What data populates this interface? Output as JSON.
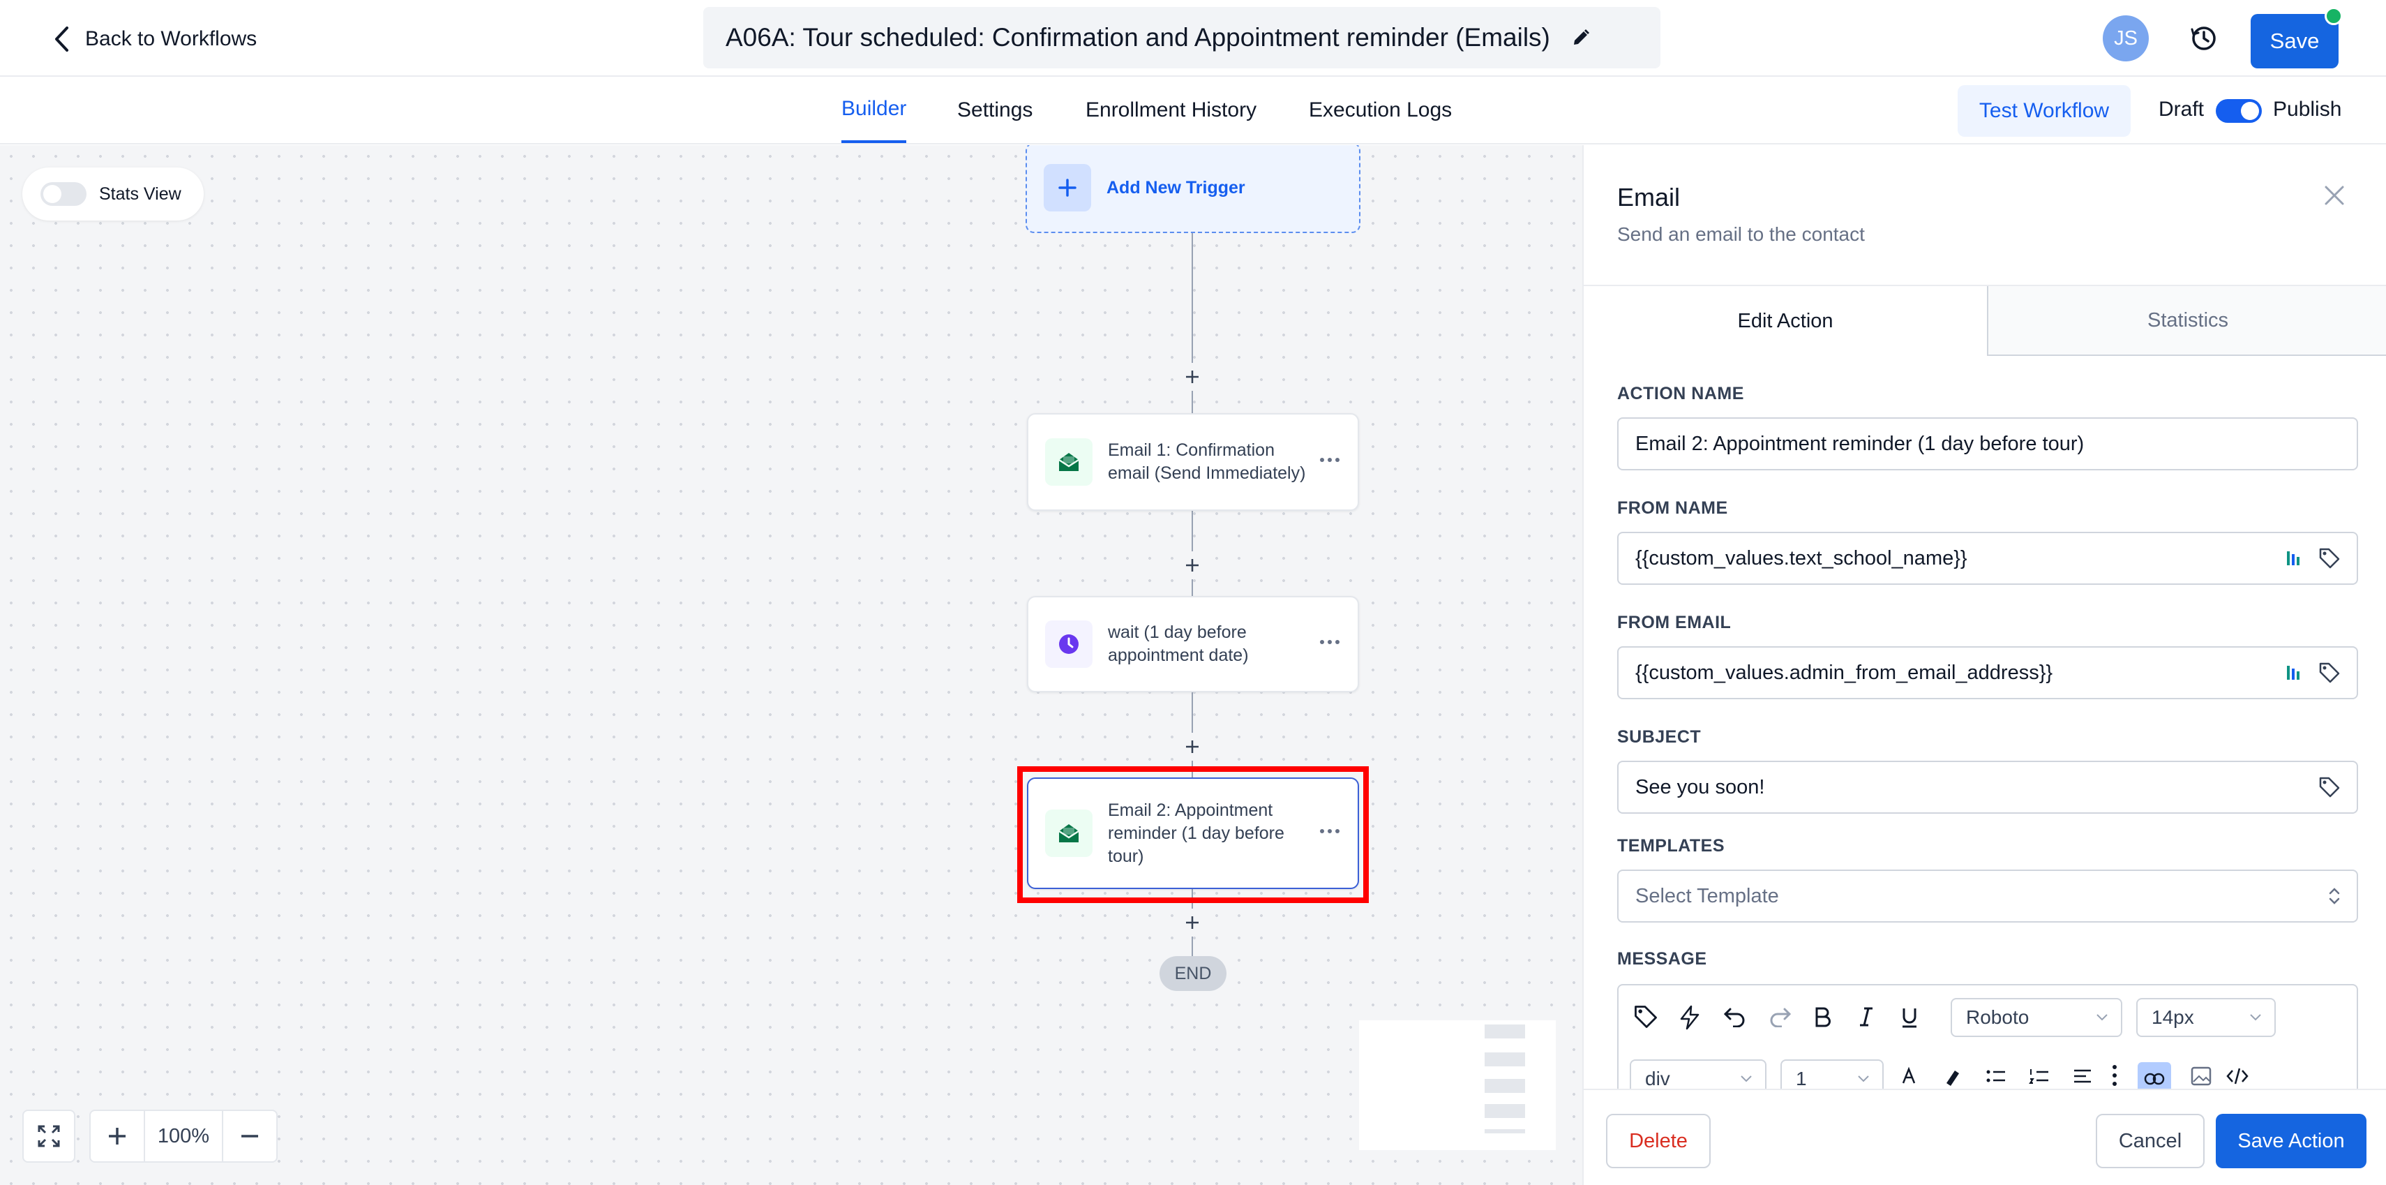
{
  "header": {
    "back_label": "Back to Workflows",
    "workflow_title": "A06A: Tour scheduled: Confirmation and Appointment reminder (Emails)",
    "avatar_initials": "JS",
    "save_label": "Save"
  },
  "nav": {
    "tabs": [
      {
        "label": "Builder",
        "active": true
      },
      {
        "label": "Settings",
        "active": false
      },
      {
        "label": "Enrollment History",
        "active": false
      },
      {
        "label": "Execution Logs",
        "active": false
      }
    ],
    "test_workflow_label": "Test Workflow",
    "draft_label": "Draft",
    "publish_label": "Publish",
    "published": true
  },
  "canvas": {
    "stats_view_label": "Stats View",
    "stats_view_on": false,
    "add_trigger_label": "Add New Trigger",
    "nodes": [
      {
        "label": "Email 1: Confirmation email (Send Immediately)",
        "icon": "email-icon"
      },
      {
        "label": "wait (1 day before appointment date)",
        "icon": "clock-icon"
      },
      {
        "label": "Email 2: Appointment reminder (1 day before tour)",
        "icon": "email-icon"
      }
    ],
    "end_label": "END",
    "zoom_value": "100%"
  },
  "panel": {
    "title": "Email",
    "subtitle": "Send an email to the contact",
    "tabs": [
      {
        "label": "Edit Action",
        "active": true
      },
      {
        "label": "Statistics",
        "active": false
      }
    ],
    "fields": {
      "action_name": {
        "label": "ACTION NAME",
        "value": "Email 2: Appointment reminder (1 day before tour)"
      },
      "from_name": {
        "label": "FROM NAME",
        "value": "{{custom_values.text_school_name}}"
      },
      "from_email": {
        "label": "FROM EMAIL",
        "value": "{{custom_values.admin_from_email_address}}"
      },
      "subject": {
        "label": "SUBJECT",
        "value": "See you soon!"
      },
      "templates": {
        "label": "TEMPLATES",
        "placeholder": "Select Template"
      }
    },
    "message": {
      "label": "MESSAGE",
      "font_family": "Roboto",
      "font_size": "14px",
      "block_type": "div",
      "line_height": "1"
    },
    "delete_label": "Delete",
    "cancel_label": "Cancel",
    "save_action_label": "Save Action"
  },
  "colors": {
    "primary": "#155eef",
    "save_button": "#1565e0",
    "delete_text": "#d92d20",
    "highlight_border": "#ff0000",
    "online_dot": "#16b364"
  }
}
